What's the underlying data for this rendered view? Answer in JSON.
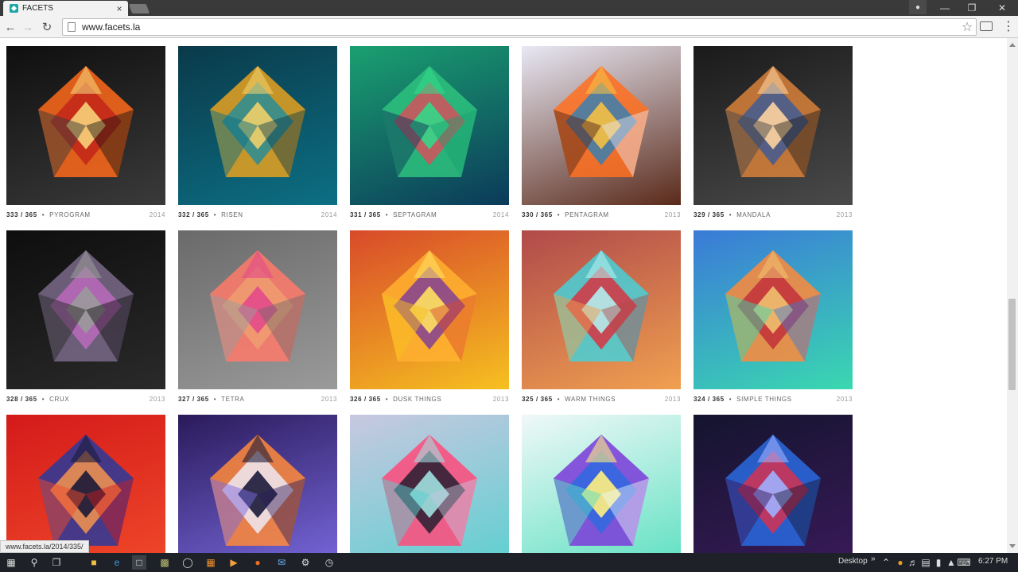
{
  "browser": {
    "tab_title": "FACETS",
    "tab_close": "×",
    "url": "www.facets.la",
    "status_url": "www.facets.la/2014/335/"
  },
  "icons": {
    "back": "back-arrow-icon",
    "forward": "forward-arrow-icon",
    "reload": "reload-icon",
    "star": "bookmark-star-icon",
    "menu": "menu-icon"
  },
  "gallery": {
    "rows": [
      [
        {
          "num": "333 / 365",
          "name": "PYROGRAM",
          "year": "2014",
          "colors": [
            "#0f0f0f",
            "#3a3a3a",
            "#ff6a1a",
            "#c0221a",
            "#f6d37a"
          ]
        },
        {
          "num": "332 / 365",
          "name": "RISEN",
          "year": "2014",
          "colors": [
            "#0a3a4a",
            "#0c6f84",
            "#e8a11f",
            "#1f8c9f",
            "#f0d06a"
          ]
        },
        {
          "num": "331 / 365",
          "name": "SEPTAGRAM",
          "year": "2014",
          "colors": [
            "#1aa070",
            "#0b3a5a",
            "#2ec27e",
            "#e04a5a",
            "#34d88a"
          ]
        },
        {
          "num": "330 / 365",
          "name": "PENTAGRAM",
          "year": "2013",
          "colors": [
            "#e8e8f4",
            "#5a2a1a",
            "#ff7020",
            "#2f7fb8",
            "#f5c044"
          ]
        },
        {
          "num": "329 / 365",
          "name": "MANDALA",
          "year": "2013",
          "colors": [
            "#1a1a1a",
            "#4a4a4a",
            "#d8803a",
            "#3a5a9a",
            "#ffd4a0"
          ]
        }
      ],
      [
        {
          "num": "328 / 365",
          "name": "CRUX",
          "year": "2013",
          "colors": [
            "#0e0e0e",
            "#2a2a2a",
            "#7a6a8a",
            "#c06ac0",
            "#9a9a9a"
          ]
        },
        {
          "num": "327 / 365",
          "name": "TETRA",
          "year": "2013",
          "colors": [
            "#6a6a6a",
            "#9a9a9a",
            "#ff7a6a",
            "#f0a070",
            "#e24a8a"
          ]
        },
        {
          "num": "326 / 365",
          "name": "DUSK THINGS",
          "year": "2013",
          "colors": [
            "#d84a2a",
            "#f6c020",
            "#ffb030",
            "#7a3a9a",
            "#ffe060"
          ]
        },
        {
          "num": "325 / 365",
          "name": "WARM THINGS",
          "year": "2013",
          "colors": [
            "#b04a4a",
            "#f0a050",
            "#48d0d8",
            "#e02a3a",
            "#b0f0f0"
          ]
        },
        {
          "num": "324 / 365",
          "name": "SIMPLE THINGS",
          "year": "2013",
          "colors": [
            "#3a7ad8",
            "#3ad8b0",
            "#ff8a3a",
            "#c02a3a",
            "#f0c070"
          ]
        }
      ],
      [
        {
          "num": "",
          "name": "",
          "year": "",
          "colors": [
            "#d41a1a",
            "#f04a2a",
            "#2a3a9a",
            "#ff9a4a",
            "#1a1a3a"
          ]
        },
        {
          "num": "",
          "name": "",
          "year": "",
          "colors": [
            "#2a1a5a",
            "#7a6ae0",
            "#ff8a3a",
            "#f0f0ff",
            "#1a1a3a"
          ]
        },
        {
          "num": "",
          "name": "",
          "year": "",
          "colors": [
            "#c8c8e0",
            "#5ad0d0",
            "#ff4a7a",
            "#1a1a2a",
            "#a0e0e0"
          ]
        },
        {
          "num": "",
          "name": "",
          "year": "",
          "colors": [
            "#f0f8f8",
            "#5ae0c0",
            "#7a3ad8",
            "#2a6ae0",
            "#fff080"
          ]
        },
        {
          "num": "",
          "name": "",
          "year": "",
          "colors": [
            "#14142e",
            "#3a1a5a",
            "#2a6ae0",
            "#e0304a",
            "#a0b0ff"
          ]
        }
      ]
    ],
    "separator": "•"
  },
  "taskbar": {
    "desktop_label": "Desktop",
    "chevrons": "»",
    "time": "6:27 PM"
  }
}
